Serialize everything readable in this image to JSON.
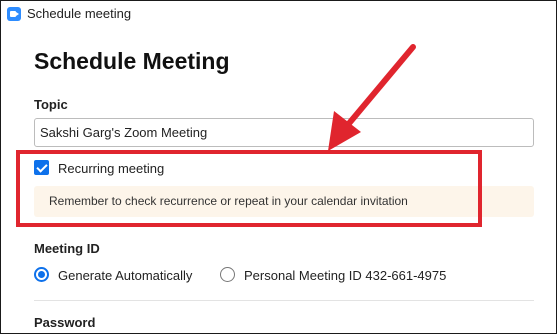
{
  "window": {
    "title": "Schedule meeting",
    "icon": "zoom-app-icon"
  },
  "page": {
    "title": "Schedule Meeting"
  },
  "topic": {
    "label": "Topic",
    "value": "Sakshi Garg's Zoom Meeting"
  },
  "recurring": {
    "label": "Recurring meeting",
    "checked": true,
    "notice": "Remember to check recurrence or repeat in your calendar invitation"
  },
  "meeting_id": {
    "label": "Meeting ID",
    "options": [
      {
        "label": "Generate Automatically",
        "selected": true
      },
      {
        "label": "Personal Meeting ID 432-661-4975",
        "selected": false
      }
    ]
  },
  "password": {
    "label": "Password"
  },
  "colors": {
    "accent": "#0e71eb",
    "annotation": "#e0252e",
    "notice_bg": "#fdf5ea"
  }
}
